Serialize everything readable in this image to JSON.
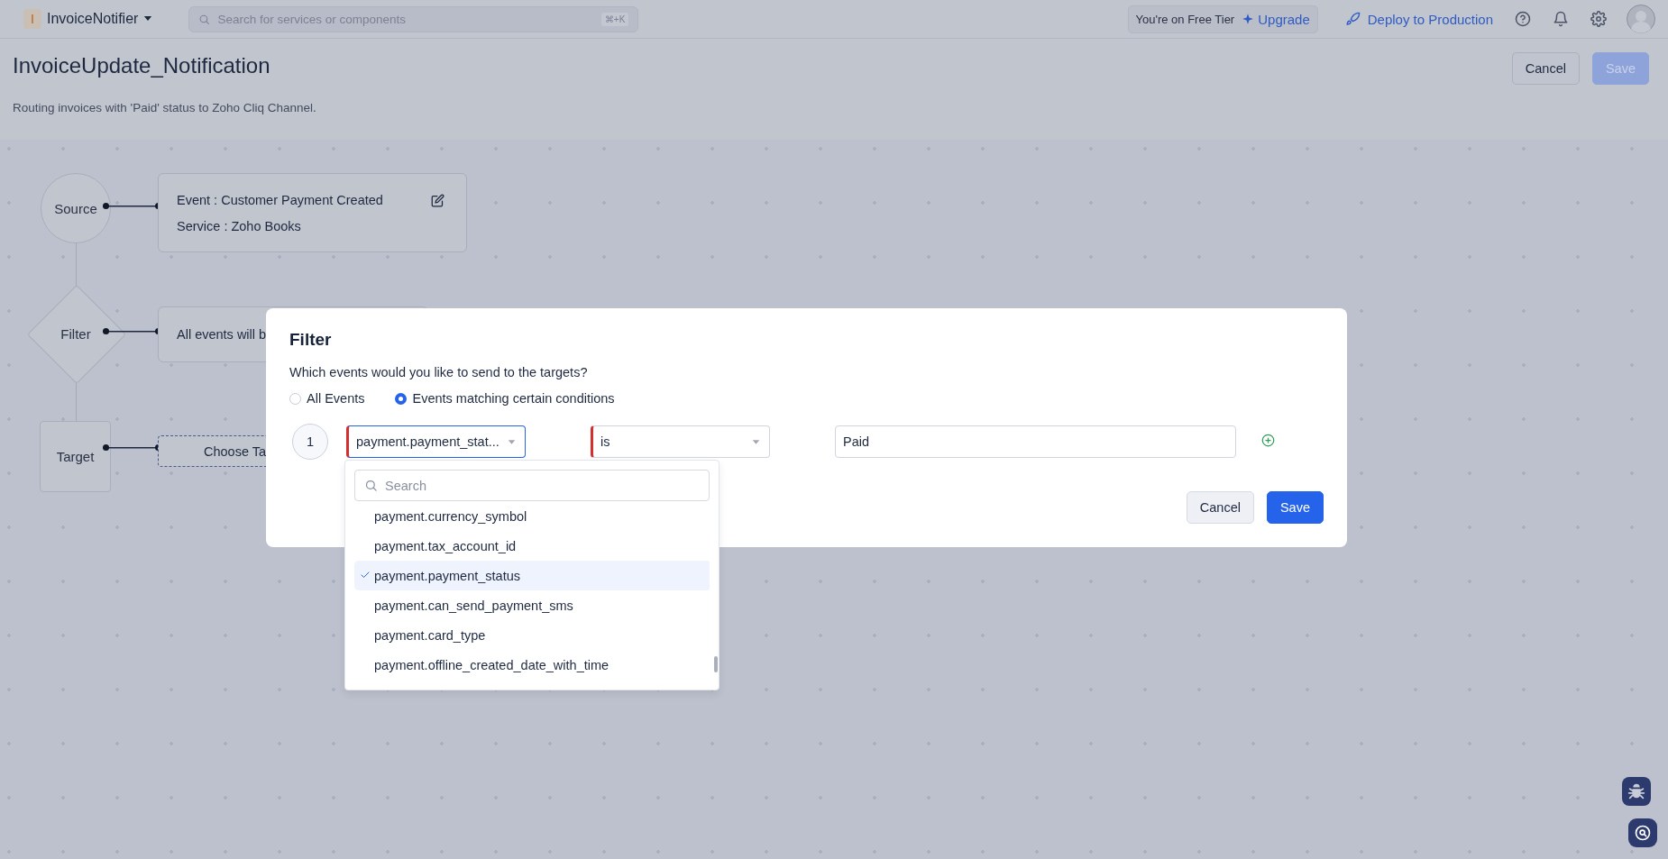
{
  "top_bar": {
    "app_letter": "I",
    "app_name": "InvoiceNotifier",
    "search": {
      "placeholder": "Search for services or components",
      "shortcut": "⌘+K"
    },
    "tier": {
      "label": "You're on Free Tier",
      "upgrade": "Upgrade"
    },
    "deploy": "Deploy to Production"
  },
  "header": {
    "title": "InvoiceUpdate_Notification",
    "description": "Routing invoices with 'Paid' status to Zoho Cliq Channel.",
    "buttons": [
      {
        "label": "Cancel",
        "kind": "secondary",
        "disabled": false
      },
      {
        "label": "Save",
        "kind": "primary",
        "disabled": true
      }
    ]
  },
  "flow": {
    "nodes": [
      {
        "kind": "circle",
        "label": "Source",
        "details": [
          "Event : Customer Payment Created",
          "Service : Zoho Books"
        ],
        "editable": true
      },
      {
        "kind": "diamond",
        "label": "Filter",
        "details": [
          "All events will b"
        ]
      },
      {
        "kind": "square",
        "label": "Target",
        "placeholder": "Choose Ta"
      }
    ]
  },
  "filter_dialog": {
    "title": "Filter",
    "question": "Which events would you like to send to the targets?",
    "options": [
      {
        "label": "All Events",
        "selected": false
      },
      {
        "label": "Events matching certain conditions",
        "selected": true
      }
    ],
    "conditions": [
      {
        "number": "1",
        "field": {
          "text": "payment.payment_stat...",
          "error": true,
          "open": true
        },
        "operator": {
          "text": "is",
          "error": true
        },
        "value": "Paid"
      }
    ],
    "dropdown": {
      "search_placeholder": "Search",
      "items": [
        {
          "label": "payment.currency_symbol",
          "selected": false
        },
        {
          "label": "payment.tax_account_id",
          "selected": false
        },
        {
          "label": "payment.payment_status",
          "selected": true
        },
        {
          "label": "payment.can_send_payment_sms",
          "selected": false
        },
        {
          "label": "payment.card_type",
          "selected": false
        },
        {
          "label": "payment.offline_created_date_with_time",
          "selected": false
        }
      ]
    },
    "buttons": [
      {
        "label": "Cancel",
        "kind": "secondary"
      },
      {
        "label": "Save",
        "kind": "primary"
      }
    ]
  }
}
